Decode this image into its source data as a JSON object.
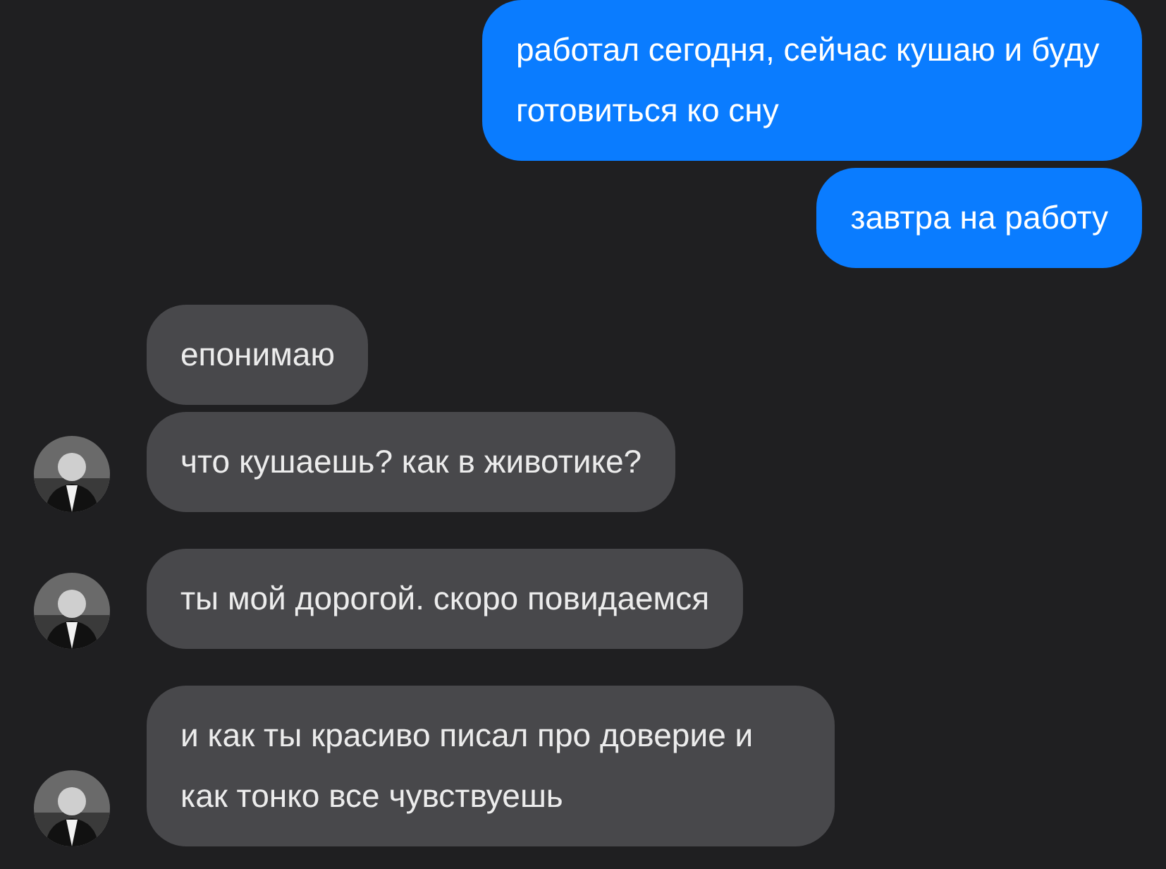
{
  "messages": [
    {
      "kind": "sent",
      "text": "работал сегодня, сейчас кушаю и буду готовиться ко сну"
    },
    {
      "kind": "sent",
      "text": "завтра на работу"
    },
    {
      "kind": "received",
      "text": "епонимаю",
      "avatar": false
    },
    {
      "kind": "received",
      "text": "что кушаешь? как в животике?",
      "avatar": true
    },
    {
      "kind": "received",
      "text": "ты мой дорогой. скоро повидаемся",
      "avatar": true
    },
    {
      "kind": "received",
      "text": "и как ты красиво писал про доверие и как тонко все чувствуешь",
      "avatar": true
    }
  ]
}
